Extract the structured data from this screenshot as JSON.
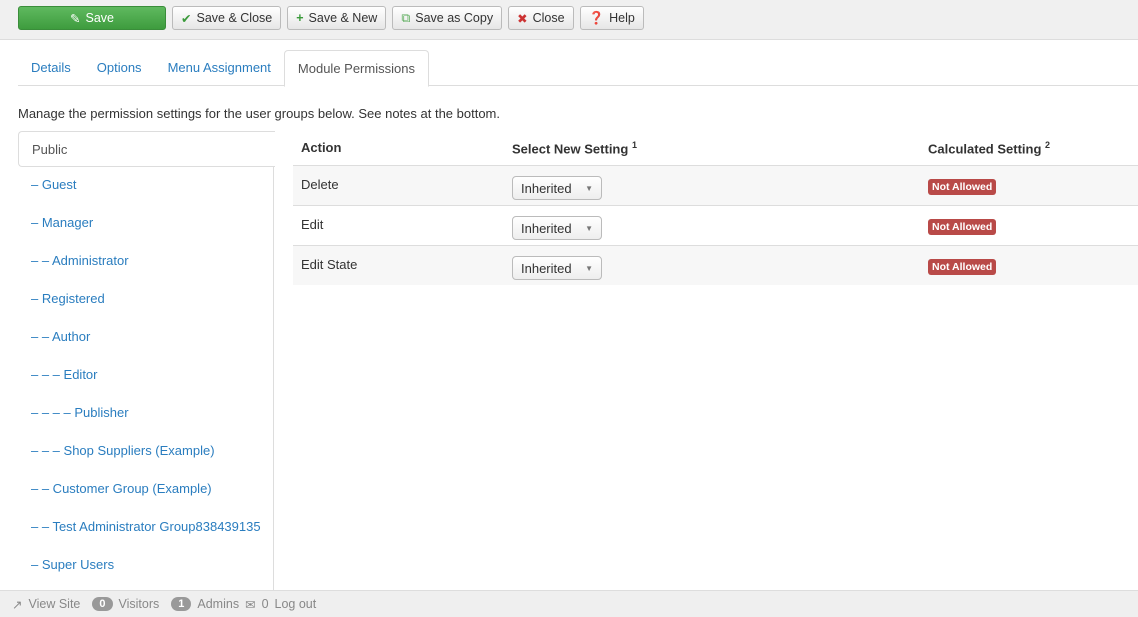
{
  "toolbar": {
    "save": "Save",
    "save_close": "Save & Close",
    "save_new": "Save & New",
    "save_copy": "Save as Copy",
    "close": "Close",
    "help": "Help"
  },
  "tabs": [
    "Details",
    "Options",
    "Menu Assignment",
    "Module Permissions"
  ],
  "description": "Manage the permission settings for the user groups below. See notes at the bottom.",
  "groups": [
    "Public",
    "– Guest",
    "– Manager",
    "– – Administrator",
    "– Registered",
    "– – Author",
    "– – – Editor",
    "– – – – Publisher",
    "– – – Shop Suppliers (Example)",
    "– – Customer Group (Example)",
    "– – Test Administrator Group838439135",
    "– Super Users"
  ],
  "table": {
    "headers": {
      "action": "Action",
      "select": "Select New Setting",
      "select_note": "1",
      "calc": "Calculated Setting",
      "calc_note": "2"
    },
    "rows": [
      {
        "action": "Delete",
        "setting": "Inherited",
        "calculated": "Not Allowed"
      },
      {
        "action": "Edit",
        "setting": "Inherited",
        "calculated": "Not Allowed"
      },
      {
        "action": "Edit State",
        "setting": "Inherited",
        "calculated": "Not Allowed"
      }
    ]
  },
  "status": {
    "view_site": "View Site",
    "visitors_count": "0",
    "visitors": "Visitors",
    "admins_count": "1",
    "admins": "Admins",
    "messages_count": "0",
    "logout": "Log out"
  }
}
